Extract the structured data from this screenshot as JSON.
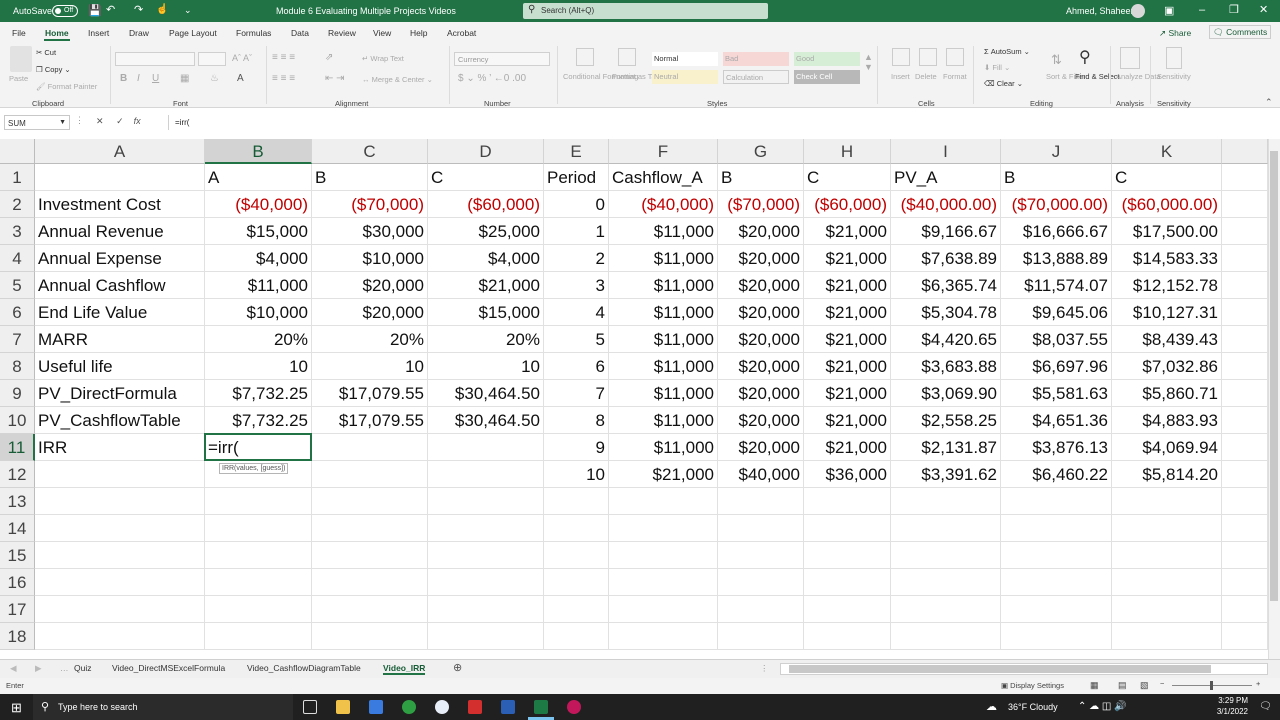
{
  "titlebar": {
    "autosave": "AutoSave",
    "autosave_state": "Off",
    "filename": "Module 6 Evaluating Multiple Projects Videos",
    "search_placeholder": "Search (Alt+Q)",
    "user": "Ahmed, Shaheen"
  },
  "menu": {
    "items": [
      "File",
      "Home",
      "Insert",
      "Draw",
      "Page Layout",
      "Formulas",
      "Data",
      "Review",
      "View",
      "Help",
      "Acrobat"
    ],
    "share": "Share",
    "comments": "Comments"
  },
  "ribbon": {
    "groups": {
      "clipboard": "Clipboard",
      "font": "Font",
      "alignment": "Alignment",
      "number": "Number",
      "styles": "Styles",
      "cells": "Cells",
      "editing": "Editing",
      "analysis": "Analysis",
      "sensitivity": "Sensitivity"
    },
    "paste": "Paste",
    "cut": "Cut",
    "copy": "Copy",
    "format_painter": "Format Painter",
    "wrap_text": "Wrap Text",
    "merge_center": "Merge & Center",
    "number_format": "Currency",
    "conditional_formatting": "Conditional Formatting",
    "format_as_table": "Format as Table",
    "styles_list": [
      "Normal",
      "Bad",
      "Good",
      "Neutral",
      "Calculation",
      "Check Cell"
    ],
    "insert": "Insert",
    "delete": "Delete",
    "format": "Format",
    "autosum": "AutoSum",
    "fill": "Fill",
    "clear": "Clear",
    "sort_filter": "Sort & Filter",
    "find_select": "Find & Select",
    "analyze_data": "Analyze Data",
    "sensitivity": "Sensitivity"
  },
  "formula_bar": {
    "name_box": "SUM",
    "formula": "=irr("
  },
  "columns": [
    "A",
    "B",
    "C",
    "D",
    "E",
    "F",
    "G",
    "H",
    "I",
    "J",
    "K"
  ],
  "rows": [
    "1",
    "2",
    "3",
    "4",
    "5",
    "6",
    "7",
    "8",
    "9",
    "10",
    "11",
    "12",
    "13",
    "14",
    "15",
    "16",
    "17",
    "18"
  ],
  "cells": [
    [
      "",
      "A",
      "B",
      "C",
      "Period",
      "Cashflow_A",
      "B",
      "C",
      "PV_A",
      "B",
      "C"
    ],
    [
      "Investment Cost",
      "($40,000)",
      "($70,000)",
      "($60,000)",
      "0",
      "($40,000)",
      "($70,000)",
      "($60,000)",
      "($40,000.00)",
      "($70,000.00)",
      "($60,000.00)"
    ],
    [
      "Annual Revenue",
      "$15,000",
      "$30,000",
      "$25,000",
      "1",
      "$11,000",
      "$20,000",
      "$21,000",
      "$9,166.67",
      "$16,666.67",
      "$17,500.00"
    ],
    [
      "Annual Expense",
      "$4,000",
      "$10,000",
      "$4,000",
      "2",
      "$11,000",
      "$20,000",
      "$21,000",
      "$7,638.89",
      "$13,888.89",
      "$14,583.33"
    ],
    [
      "Annual Cashflow",
      "$11,000",
      "$20,000",
      "$21,000",
      "3",
      "$11,000",
      "$20,000",
      "$21,000",
      "$6,365.74",
      "$11,574.07",
      "$12,152.78"
    ],
    [
      "End Life Value",
      "$10,000",
      "$20,000",
      "$15,000",
      "4",
      "$11,000",
      "$20,000",
      "$21,000",
      "$5,304.78",
      "$9,645.06",
      "$10,127.31"
    ],
    [
      "MARR",
      "20%",
      "20%",
      "20%",
      "5",
      "$11,000",
      "$20,000",
      "$21,000",
      "$4,420.65",
      "$8,037.55",
      "$8,439.43"
    ],
    [
      "Useful life",
      "10",
      "10",
      "10",
      "6",
      "$11,000",
      "$20,000",
      "$21,000",
      "$3,683.88",
      "$6,697.96",
      "$7,032.86"
    ],
    [
      "PV_DirectFormula",
      "$7,732.25",
      "$17,079.55",
      "$30,464.50",
      "7",
      "$11,000",
      "$20,000",
      "$21,000",
      "$3,069.90",
      "$5,581.63",
      "$5,860.71"
    ],
    [
      "PV_CashflowTable",
      "$7,732.25",
      "$17,079.55",
      "$30,464.50",
      "8",
      "$11,000",
      "$20,000",
      "$21,000",
      "$2,558.25",
      "$4,651.36",
      "$4,883.93"
    ],
    [
      "IRR",
      "=irr(",
      "",
      "",
      "9",
      "$11,000",
      "$20,000",
      "$21,000",
      "$2,131.87",
      "$3,876.13",
      "$4,069.94"
    ],
    [
      "",
      "",
      "",
      "",
      "10",
      "$21,000",
      "$40,000",
      "$36,000",
      "$3,391.62",
      "$6,460.22",
      "$5,814.20"
    ]
  ],
  "tooltip": "IRR(values, [guess])",
  "sheet_tabs": [
    "Quiz",
    "Video_DirectMSExcelFormula",
    "Video_CashflowDiagramTable",
    "Video_IRR"
  ],
  "active_tab": "Video_IRR",
  "status": {
    "mode": "Enter",
    "display_settings": "Display Settings"
  },
  "taskbar": {
    "search_placeholder": "Type here to search",
    "weather": "36°F  Cloudy",
    "time": "3:29 PM",
    "date": "3/1/2022"
  },
  "colors": {
    "excel_green": "#217346",
    "negative_red": "#c00000"
  }
}
